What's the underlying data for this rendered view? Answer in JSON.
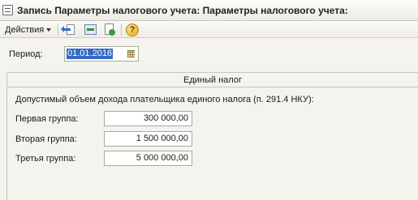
{
  "window": {
    "title": "Запись Параметры налогового учета: Параметры налогового учета:",
    "icon": "form-icon"
  },
  "toolbar": {
    "actions_label": "Действия",
    "icons": [
      "export-icon",
      "refresh-icon",
      "add-copy-icon",
      "help-icon"
    ],
    "help_glyph": "?"
  },
  "period": {
    "label": "Период:",
    "value": "01.01.2016"
  },
  "tax_panel": {
    "header": "Единый налог",
    "limit_title": "Допустимый объем дохода плательщика единого налога (п. 291.4 НКУ):",
    "groups": [
      {
        "label": "Первая группа:",
        "value": "300 000,00"
      },
      {
        "label": "Вторая группа:",
        "value": "1 500 000,00"
      },
      {
        "label": "Третья группа:",
        "value": "5 000 000,00"
      }
    ]
  },
  "colors": {
    "selection": "#3169c6",
    "background": "#f4f3ee",
    "help_icon": "#e8a317"
  }
}
